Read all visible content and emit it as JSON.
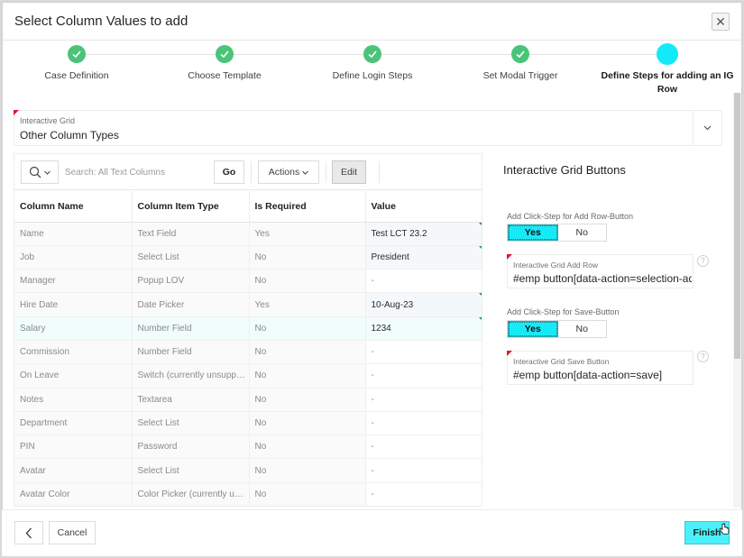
{
  "dialog": {
    "title": "Select Column Values to add",
    "close_icon": "close-icon"
  },
  "wizard": {
    "steps": [
      {
        "label": "Case Definition",
        "status": "complete"
      },
      {
        "label": "Choose Template",
        "status": "complete"
      },
      {
        "label": "Define Login Steps",
        "status": "complete"
      },
      {
        "label": "Set Modal Trigger",
        "status": "complete"
      },
      {
        "label": "Define Steps for adding an IG Row",
        "status": "current"
      }
    ],
    "colors": {
      "complete": "#4bc47a",
      "current": "#12eaf8"
    }
  },
  "interactive_grid_select": {
    "label": "Interactive Grid",
    "value": "Other Column Types",
    "required": true
  },
  "grid": {
    "toolbar": {
      "search_icon": "search-icon",
      "search_placeholder": "Search: All Text Columns",
      "go_label": "Go",
      "actions_label": "Actions",
      "edit_label": "Edit"
    },
    "columns": [
      "Column Name",
      "Column Item Type",
      "Is Required",
      "Value"
    ],
    "rows": [
      {
        "name": "Name",
        "type": "Text Field",
        "required": "Yes",
        "value": "Test LCT 23.2",
        "changed": true
      },
      {
        "name": "Job",
        "type": "Select List",
        "required": "No",
        "value": "President",
        "changed": true
      },
      {
        "name": "Manager",
        "type": "Popup LOV",
        "required": "No",
        "value": "-",
        "changed": false
      },
      {
        "name": "Hire Date",
        "type": "Date Picker",
        "required": "Yes",
        "value": "10-Aug-23",
        "changed": true
      },
      {
        "name": "Salary",
        "type": "Number Field",
        "required": "No",
        "value": "1234",
        "changed": true,
        "active": true
      },
      {
        "name": "Commission",
        "type": "Number Field",
        "required": "No",
        "value": "-",
        "changed": false
      },
      {
        "name": "On Leave",
        "type": "Switch (currently unsupported)",
        "required": "No",
        "value": "-",
        "changed": false
      },
      {
        "name": "Notes",
        "type": "Textarea",
        "required": "No",
        "value": "-",
        "changed": false
      },
      {
        "name": "Department",
        "type": "Select List",
        "required": "No",
        "value": "-",
        "changed": false
      },
      {
        "name": "PIN",
        "type": "Password",
        "required": "No",
        "value": "-",
        "changed": false
      },
      {
        "name": "Avatar",
        "type": "Select List",
        "required": "No",
        "value": "-",
        "changed": false
      },
      {
        "name": "Avatar Color",
        "type": "Color Picker (currently unsupported)",
        "required": "No",
        "value": "-",
        "changed": false
      }
    ]
  },
  "buttons_panel": {
    "title": "Interactive Grid Buttons",
    "add_row_toggle": {
      "label": "Add Click-Step for Add Row-Button",
      "yes": "Yes",
      "no": "No",
      "selected": "Yes"
    },
    "add_row_field": {
      "label": "Interactive Grid Add Row",
      "value": "#emp button[data-action=selection-add-row]",
      "required": true
    },
    "save_toggle": {
      "label": "Add Click-Step for Save-Button",
      "yes": "Yes",
      "no": "No",
      "selected": "Yes"
    },
    "save_field": {
      "label": "Interactive Grid Save Button",
      "value": "#emp button[data-action=save]",
      "required": true
    },
    "help_glyph": "?"
  },
  "footer": {
    "previous_icon": "chevron-left-icon",
    "cancel_label": "Cancel",
    "finish_label": "Finish",
    "accent": "#4cf0fa"
  }
}
